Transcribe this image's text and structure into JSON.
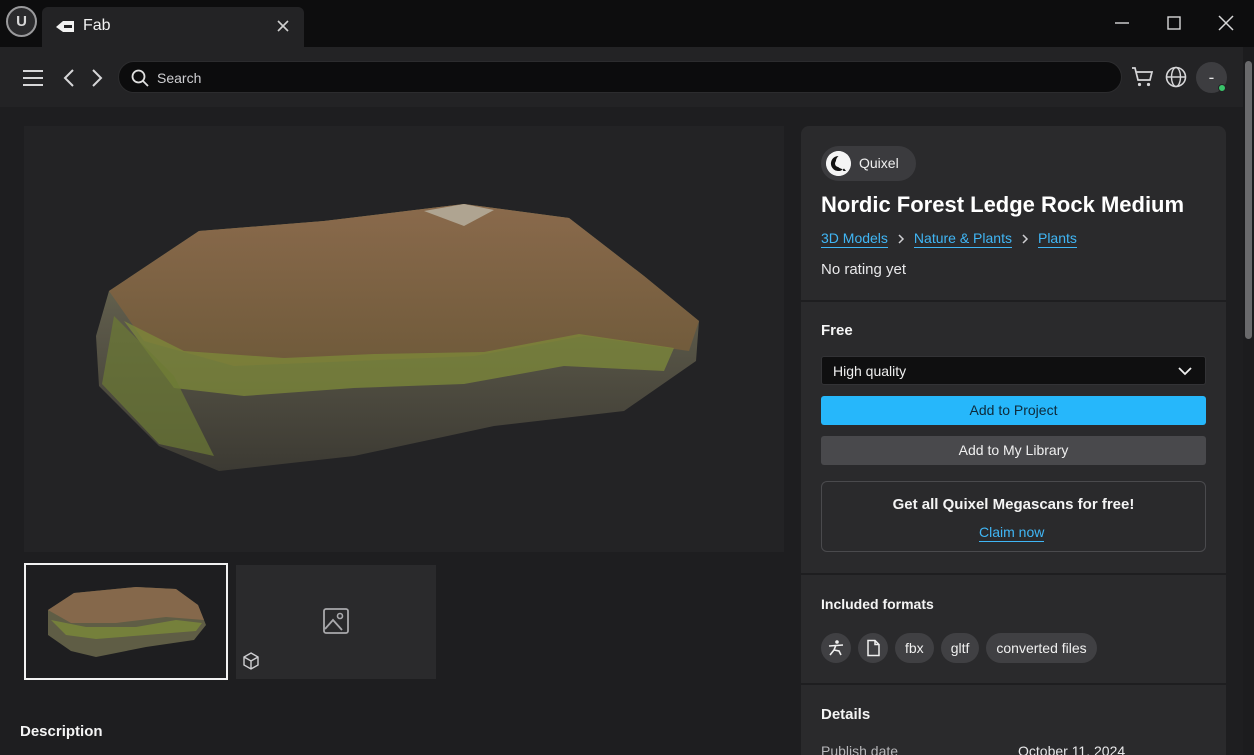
{
  "app": {
    "tab_title": "Fab"
  },
  "search": {
    "placeholder": "Search"
  },
  "user": {
    "avatar_initial": "-"
  },
  "product": {
    "seller": "Quixel",
    "title": "Nordic Forest Ledge Rock Medium",
    "breadcrumbs": [
      "3D Models",
      "Nature & Plants",
      "Plants"
    ],
    "rating": "No rating yet",
    "price_label": "Free",
    "quality_selected": "High quality",
    "add_to_project": "Add to Project",
    "add_to_library": "Add to My Library",
    "promo_heading": "Get all Quixel Megascans for free!",
    "promo_link": "Claim now",
    "formats_label": "Included formats",
    "formats": [
      "fbx",
      "gltf",
      "converted files"
    ],
    "format_icons": [
      "zbrush-icon",
      "file-icon"
    ],
    "details_label": "Details",
    "publish_date_label": "Publish date",
    "publish_date_value": "October 11, 2024"
  },
  "content": {
    "description_heading": "Description"
  },
  "colors": {
    "accent": "#26b7fb",
    "link": "#40b6f5",
    "online": "#39c46a"
  }
}
